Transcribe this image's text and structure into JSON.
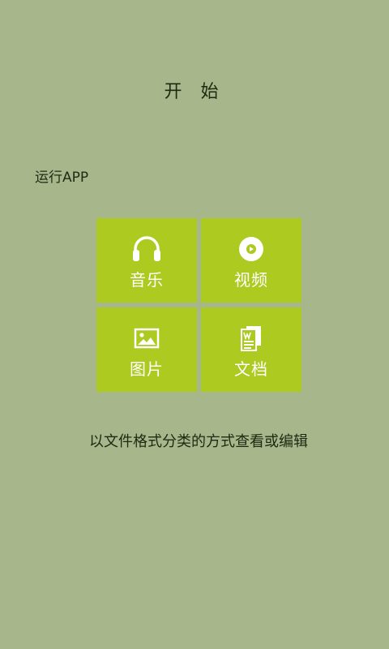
{
  "header": {
    "title": "开 始"
  },
  "intro": {
    "run_app_label": "运行APP"
  },
  "tiles": [
    {
      "label": "音乐",
      "icon": "headphones-icon"
    },
    {
      "label": "视频",
      "icon": "video-disc-icon"
    },
    {
      "label": "图片",
      "icon": "image-icon"
    },
    {
      "label": "文档",
      "icon": "document-icon"
    }
  ],
  "footer": {
    "tagline": "以文件格式分类的方式查看或编辑"
  },
  "colors": {
    "background": "#a7b78b",
    "tile": "#acca1f",
    "tile_text": "#ffffff",
    "text": "#1f2a14"
  }
}
